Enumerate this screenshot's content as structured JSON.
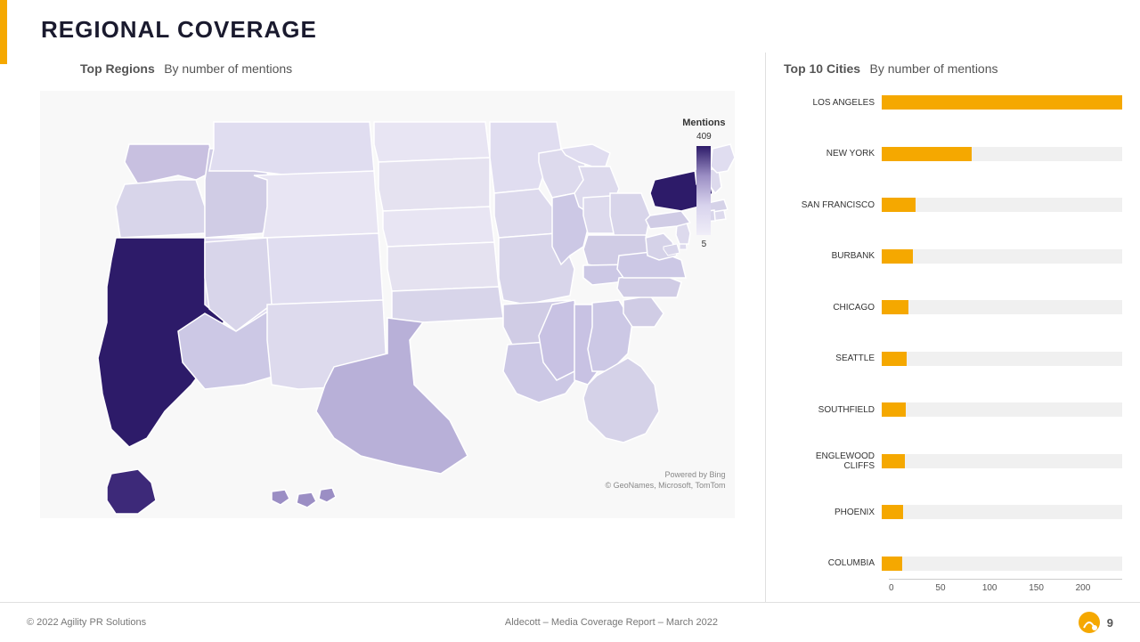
{
  "header": {
    "title": "REGIONAL COVERAGE",
    "accent_color": "#f5a800"
  },
  "left_panel": {
    "section_title": "Top Regions",
    "section_subtitle": "By number of mentions",
    "legend": {
      "title": "Mentions",
      "max_val": "409",
      "min_val": "5"
    },
    "map_credit_line1": "Powered by Bing",
    "map_credit_line2": "© GeoNames, Microsoft, TomTom"
  },
  "right_panel": {
    "chart_title": "Top 10 Cities",
    "chart_subtitle": "By number of mentions",
    "bars": [
      {
        "city": "LOS ANGELES",
        "value": 200,
        "max": 200
      },
      {
        "city": "NEW YORK",
        "value": 75,
        "max": 200
      },
      {
        "city": "SAN FRANCISCO",
        "value": 28,
        "max": 200
      },
      {
        "city": "BURBANK",
        "value": 26,
        "max": 200
      },
      {
        "city": "CHICAGO",
        "value": 22,
        "max": 200
      },
      {
        "city": "SEATTLE",
        "value": 21,
        "max": 200
      },
      {
        "city": "SOUTHFIELD",
        "value": 20,
        "max": 200
      },
      {
        "city": "ENGLEWOOD CLIFFS",
        "value": 19,
        "max": 200
      },
      {
        "city": "PHOENIX",
        "value": 18,
        "max": 200
      },
      {
        "city": "COLUMBIA",
        "value": 17,
        "max": 200
      }
    ],
    "x_axis_ticks": [
      "0",
      "50",
      "100",
      "150",
      "200"
    ]
  },
  "footer": {
    "copyright": "© 2022 Agility PR Solutions",
    "report_title": "Aldecott – Media Coverage Report – March 2022",
    "page_number": "9"
  }
}
